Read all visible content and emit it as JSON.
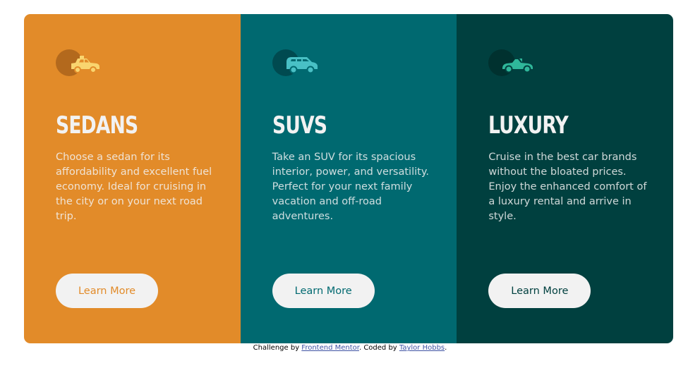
{
  "colors": {
    "sedans_bg": "#e28b29",
    "suvs_bg": "#006970",
    "luxury_bg": "#00403f",
    "text_light": "#f2f2f2",
    "button_bg": "#f2f2f2",
    "link": "#3e52a3"
  },
  "cards": [
    {
      "icon": "sedan-car-icon",
      "title": "SEDANS",
      "text": "Choose a sedan for its affordability and excellent fuel economy. Ideal for cruising in the city or on your next road trip.",
      "button_label": "Learn More"
    },
    {
      "icon": "suv-car-icon",
      "title": "SUVS",
      "text": "Take an SUV for its spacious interior, power, and versatility. Perfect for your next family vacation and off-road adventures.",
      "button_label": "Learn More"
    },
    {
      "icon": "luxury-car-icon",
      "title": "LUXURY",
      "text": "Cruise in the best car brands without the bloated prices. Enjoy the enhanced comfort of a luxury rental and arrive in style.",
      "button_label": "Learn More"
    }
  ],
  "attribution": {
    "prefix": "Challenge by ",
    "challenge_link": "Frontend Mentor",
    "middle": ". Coded by ",
    "author_link": "Taylor Hobbs",
    "suffix": "."
  }
}
